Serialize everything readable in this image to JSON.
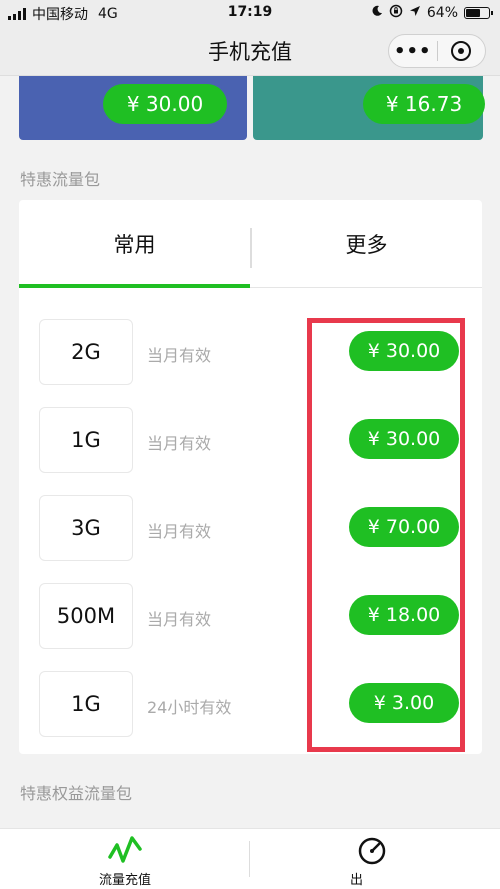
{
  "status_bar": {
    "carrier": "中国移动",
    "network": "4G",
    "time": "17:19",
    "battery": "64%",
    "battery_level": 0.64
  },
  "nav": {
    "title": "手机充值",
    "more_label": "•••"
  },
  "top_cards": [
    {
      "price": "¥ 30.00",
      "color": "#4a62b1"
    },
    {
      "price": "¥ 16.73",
      "color": "#3a978c"
    }
  ],
  "section_title": "特惠流量包",
  "tabs": [
    {
      "label": "常用",
      "active": true
    },
    {
      "label": "更多",
      "active": false
    }
  ],
  "packages": [
    {
      "size": "2G",
      "validity": "当月有效",
      "price": "¥ 30.00"
    },
    {
      "size": "1G",
      "validity": "当月有效",
      "price": "¥ 30.00"
    },
    {
      "size": "3G",
      "validity": "当月有效",
      "price": "¥ 70.00"
    },
    {
      "size": "500M",
      "validity": "当月有效",
      "price": "¥ 18.00"
    },
    {
      "size": "1G",
      "validity": "24小时有效",
      "price": "¥ 3.00"
    }
  ],
  "section2_title": "特惠权益流量包",
  "bottom_tabs": [
    {
      "label": "流量充值",
      "icon": "pulse-icon",
      "color": "#1fbf23"
    },
    {
      "label": "出",
      "icon": "speedometer-icon"
    }
  ],
  "colors": {
    "accent": "#1fbf23",
    "highlight": "#e8394c"
  }
}
